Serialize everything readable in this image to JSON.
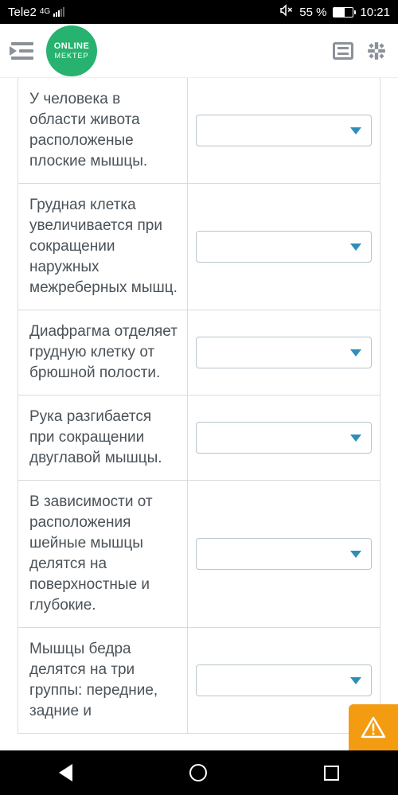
{
  "status": {
    "carrier": "Tele2",
    "network": "4G",
    "battery_pct": "55 %",
    "time": "10:21"
  },
  "logo": {
    "line1": "ONLINE",
    "line2": "MEKTEP"
  },
  "questions": [
    {
      "text": "У человека в области живота расположеные плоские мышцы."
    },
    {
      "text": "Грудная клетка увеличивается при сокращении наружных межреберных мышц."
    },
    {
      "text": "Диафрагма отделяет грудную клетку от брюшной полости."
    },
    {
      "text": "Рука разгибается при сокращении двуглавой мышцы."
    },
    {
      "text": "В зависимости от расположения шейные мышцы делятся на поверхностные и глубокие."
    },
    {
      "text": "Мышцы бедра делятся на три группы: передние, задние и"
    }
  ]
}
